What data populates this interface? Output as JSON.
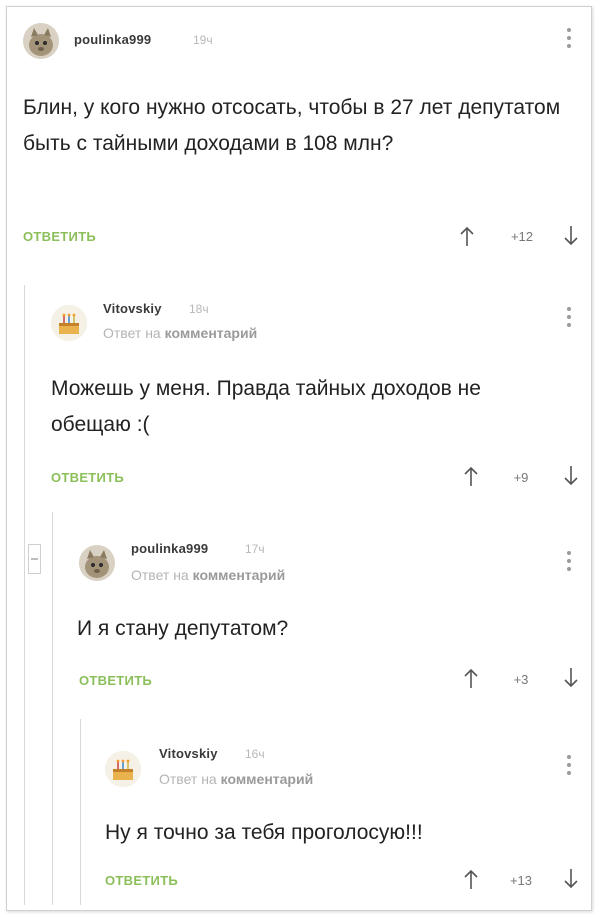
{
  "comments": [
    {
      "author": "poulinka999",
      "time": "19ч",
      "text": "Блин, у кого нужно отсосать, чтобы в 27 лет депутатом быть с тайными доходами в 108 млн?",
      "reply_label": "ОТВЕТИТЬ",
      "rating": "+12"
    },
    {
      "author": "Vitovskiy",
      "time": "18ч",
      "reply_prefix": "Ответ на",
      "reply_target": "комментарий",
      "text": "Можешь у меня. Правда тайных доходов не обещаю :(",
      "reply_label": "ОТВЕТИТЬ",
      "rating": "+9"
    },
    {
      "author": "poulinka999",
      "time": "17ч",
      "reply_prefix": "Ответ на",
      "reply_target": "комментарий",
      "text": "И я стану депутатом?",
      "reply_label": "ОТВЕТИТЬ",
      "rating": "+3"
    },
    {
      "author": "Vitovskiy",
      "time": "16ч",
      "reply_prefix": "Ответ на",
      "reply_target": "комментарий",
      "text": "Ну я точно за тебя проголосую!!!",
      "reply_label": "ОТВЕТИТЬ",
      "rating": "+13"
    }
  ],
  "colors": {
    "reply_accent": "#8bbf5a",
    "muted_text": "#b4b4b4"
  },
  "icons": [
    "cat-avatar-icon",
    "cake-avatar-icon",
    "kebab-menu-icon",
    "arrow-up-icon",
    "arrow-down-icon",
    "collapse-thread-icon"
  ]
}
